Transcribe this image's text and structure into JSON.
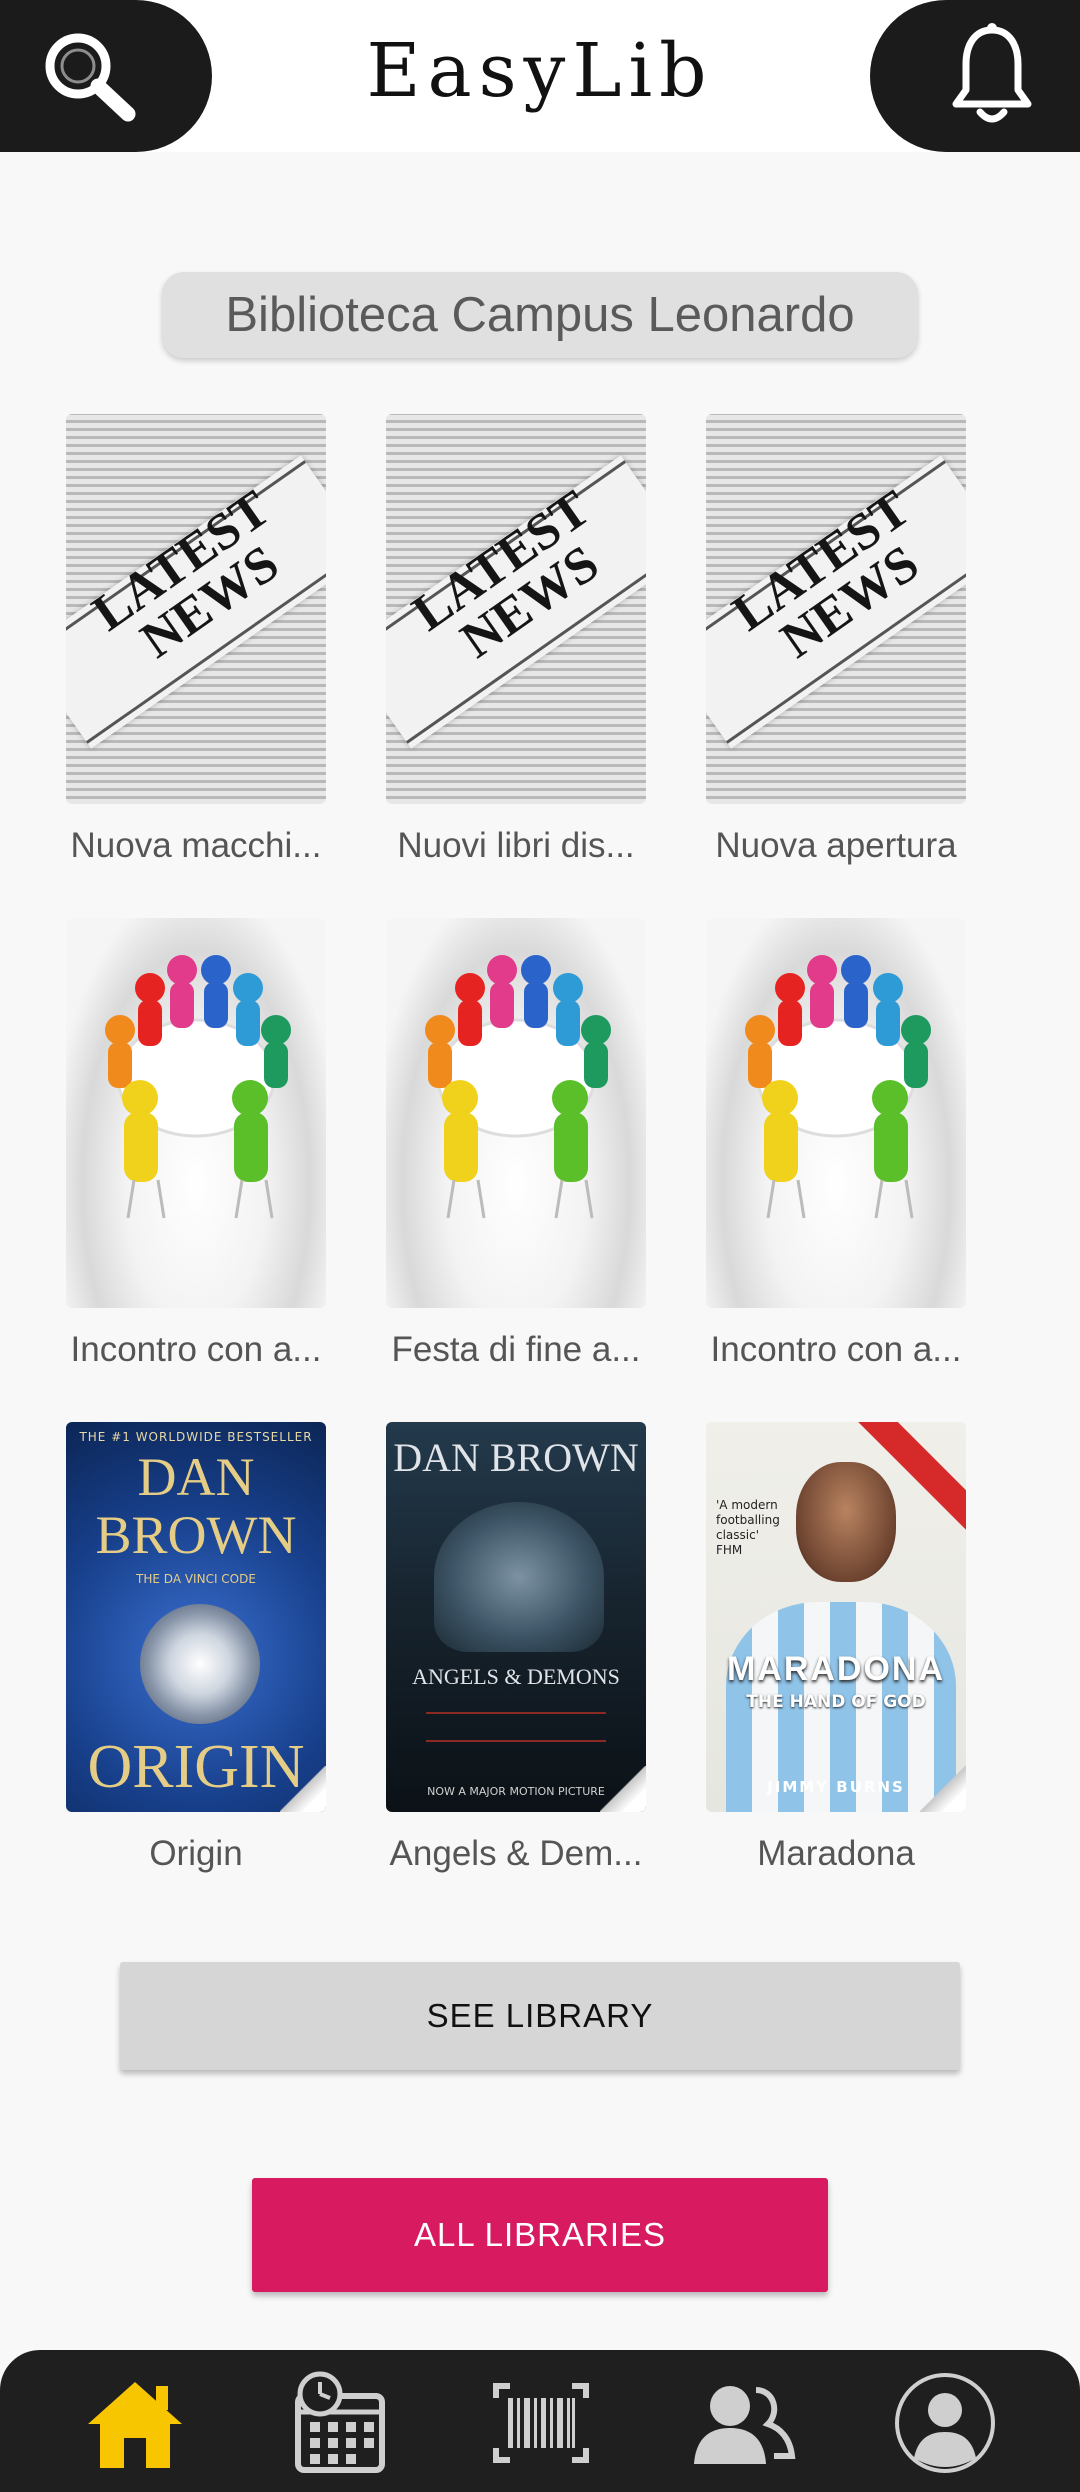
{
  "header": {
    "title": "EasyLib",
    "search_icon": "search-icon",
    "bell_icon": "bell-icon"
  },
  "library": {
    "name": "Biblioteca Campus Leonardo"
  },
  "news": [
    {
      "caption": "Nuova macchi...",
      "image_text": "LATEST NEWS"
    },
    {
      "caption": "Nuovi libri dis...",
      "image_text": "LATEST NEWS"
    },
    {
      "caption": "Nuova apertura",
      "image_text": "LATEST NEWS"
    }
  ],
  "events": [
    {
      "caption": "Incontro con a..."
    },
    {
      "caption": "Festa di fine a..."
    },
    {
      "caption": "Incontro con a..."
    }
  ],
  "books": [
    {
      "caption": "Origin",
      "cover_top": "THE #1 WORLDWIDE BESTSELLER",
      "cover_author": "DAN BROWN",
      "cover_sub": "THE DA VINCI CODE",
      "cover_title": "ORIGIN"
    },
    {
      "caption": "Angels & Dem...",
      "cover_author": "DAN BROWN",
      "cover_title": "ANGELS & DEMONS",
      "cover_foot": "NOW A MAJOR MOTION PICTURE"
    },
    {
      "caption": "Maradona",
      "cover_quote": "'A modern footballing classic' FHM",
      "cover_title": "MARADONA",
      "cover_sub": "THE HAND OF GOD",
      "cover_author": "JIMMY BURNS"
    }
  ],
  "buttons": {
    "see_library": "SEE LIBRARY",
    "all_libraries": "ALL LIBRARIES"
  },
  "nav": {
    "items": [
      "home-icon",
      "calendar-clock-icon",
      "barcode-icon",
      "users-icon",
      "account-icon"
    ],
    "active": "home-icon"
  },
  "colors": {
    "accent": "#d81b60",
    "nav_active": "#f7c600",
    "dark": "#1b1b1b"
  }
}
